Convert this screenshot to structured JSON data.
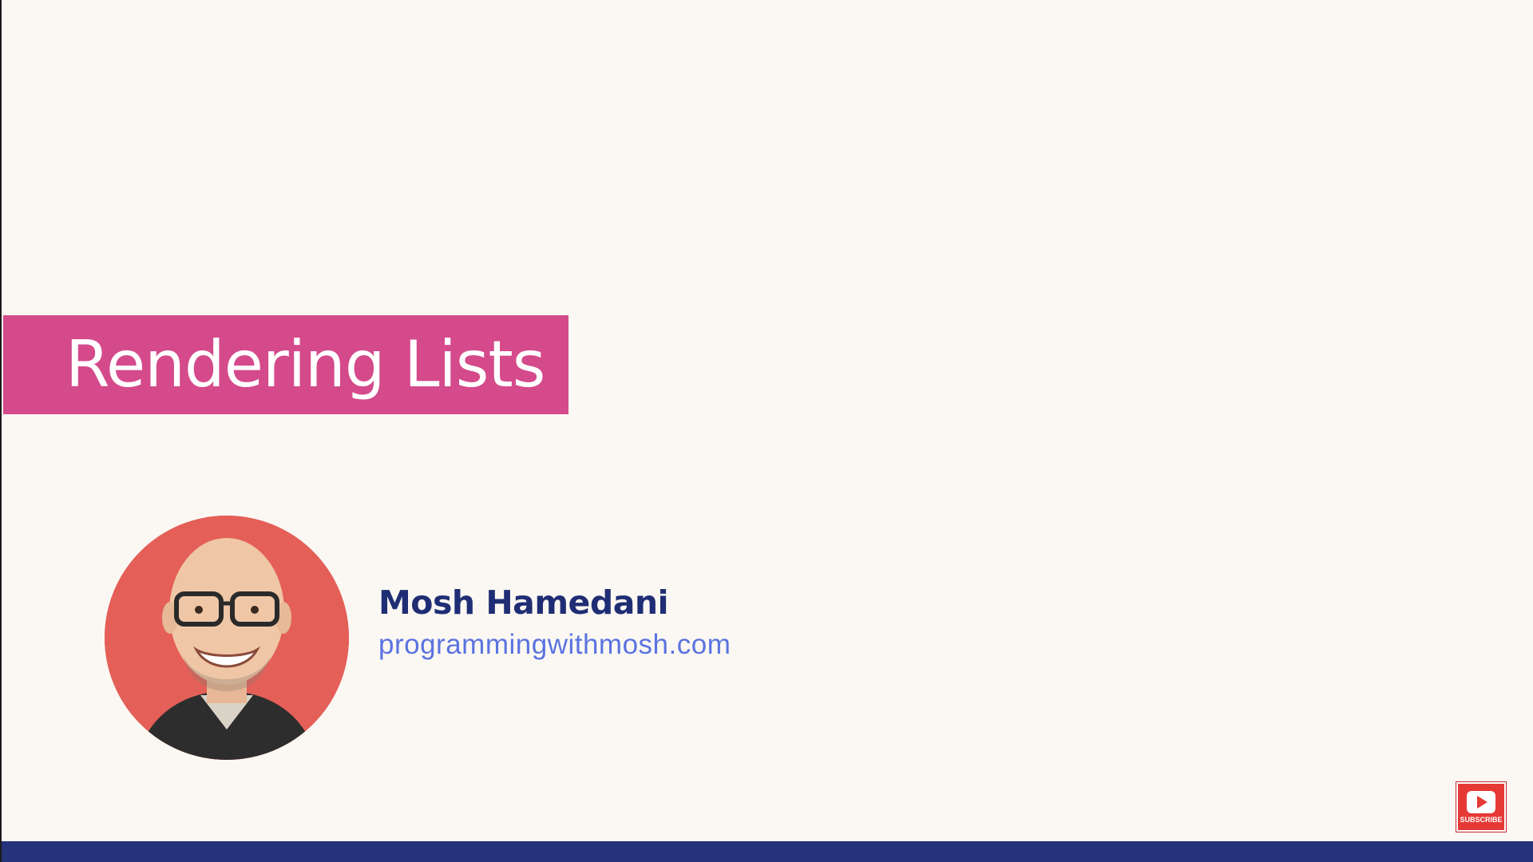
{
  "slide": {
    "title": "Rendering Lists"
  },
  "author": {
    "name": "Mosh Hamedani",
    "website": "programmingwithmosh.com",
    "avatar_icon": "person-photo-icon"
  },
  "subscribe_button": {
    "label": "SUBSCRIBE",
    "icon": "play-icon"
  },
  "colors": {
    "background": "#fbf8f3",
    "title_banner": "#d44a8b",
    "author_name": "#1f2e74",
    "author_site": "#5b73e0",
    "subscribe": "#e53935",
    "bottom_bar": "#24337a"
  }
}
